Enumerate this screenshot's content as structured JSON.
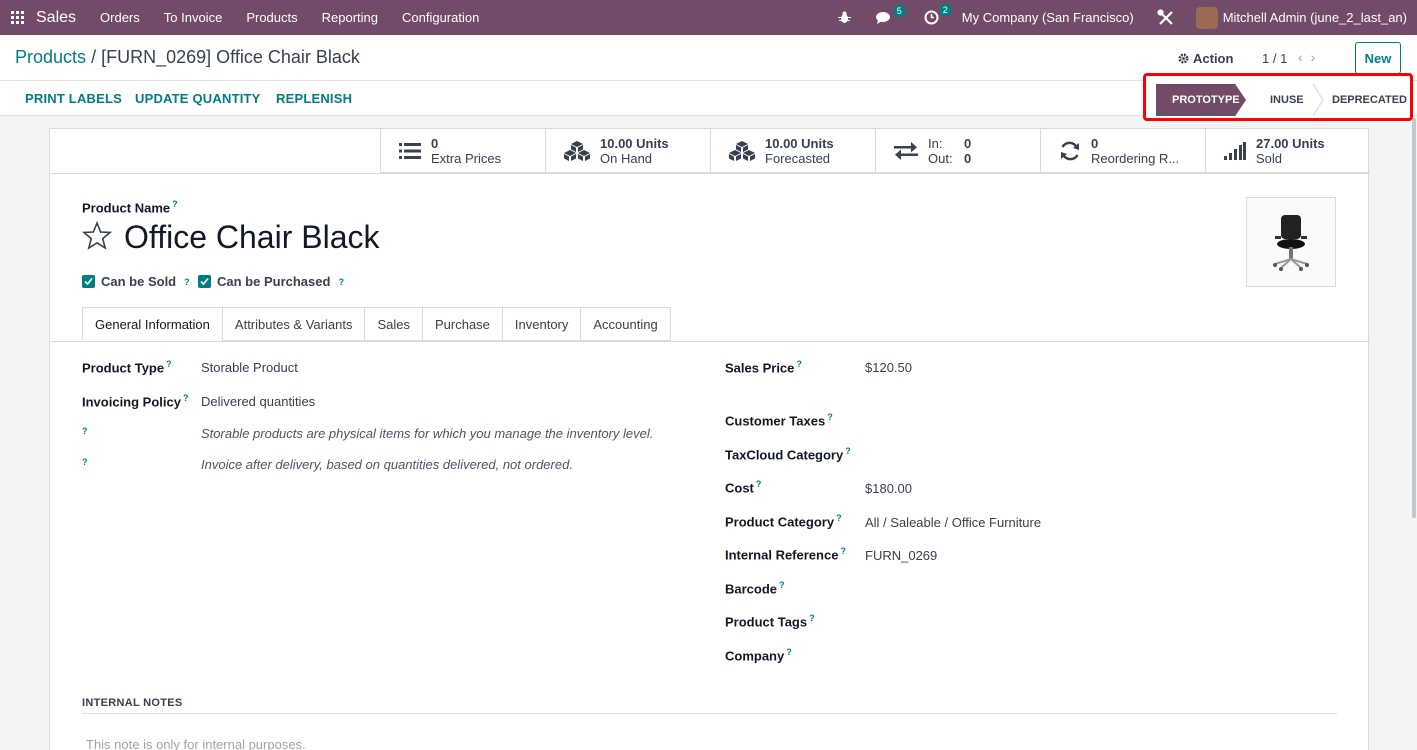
{
  "navbar": {
    "app_name": "Sales",
    "menu": [
      "Orders",
      "To Invoice",
      "Products",
      "Reporting",
      "Configuration"
    ],
    "messages_count": "5",
    "activities_count": "2",
    "company": "My Company (San Francisco)",
    "user": "Mitchell Admin (june_2_last_an)"
  },
  "control": {
    "breadcrumb_parent": "Products",
    "breadcrumb_sep": "/",
    "breadcrumb_current": "[FURN_0269] Office Chair Black",
    "action_label": "Action",
    "pager": "1 / 1",
    "new_label": "New"
  },
  "statusbar": {
    "buttons": [
      "PRINT LABELS",
      "UPDATE QUANTITY",
      "REPLENISH"
    ],
    "stages": [
      "PROTOTYPE",
      "INUSE",
      "DEPRECATED"
    ],
    "active_stage": "PROTOTYPE"
  },
  "smart_buttons": {
    "extra_prices": {
      "value": "0",
      "label": "Extra Prices"
    },
    "on_hand": {
      "value": "10.00 Units",
      "label": "On Hand"
    },
    "forecasted": {
      "value": "10.00 Units",
      "label": "Forecasted"
    },
    "in_out": {
      "in_label": "In:",
      "in_value": "0",
      "out_label": "Out:",
      "out_value": "0"
    },
    "reordering": {
      "value": "0",
      "label": "Reordering R..."
    },
    "sold": {
      "value": "27.00 Units",
      "label": "Sold"
    }
  },
  "product": {
    "name_label": "Product Name",
    "name": "Office Chair Black",
    "can_be_sold": "Can be Sold",
    "can_be_purchased": "Can be Purchased",
    "help_mark": "?"
  },
  "tabs": [
    "General Information",
    "Attributes & Variants",
    "Sales",
    "Purchase",
    "Inventory",
    "Accounting"
  ],
  "general": {
    "product_type_label": "Product Type",
    "product_type": "Storable Product",
    "invoicing_policy_label": "Invoicing Policy",
    "invoicing_policy": "Delivered quantities",
    "note_type": "Storable products are physical items for which you manage the inventory level.",
    "note_invoice": "Invoice after delivery, based on quantities delivered, not ordered.",
    "sales_price_label": "Sales Price",
    "sales_price": "$120.50",
    "customer_taxes_label": "Customer Taxes",
    "taxcloud_label": "TaxCloud Category",
    "cost_label": "Cost",
    "cost": "$180.00",
    "category_label": "Product Category",
    "category": "All / Saleable / Office Furniture",
    "internal_ref_label": "Internal Reference",
    "internal_ref": "FURN_0269",
    "barcode_label": "Barcode",
    "tags_label": "Product Tags",
    "company_label": "Company"
  },
  "notes": {
    "heading": "INTERNAL NOTES",
    "placeholder": "This note is only for internal purposes."
  }
}
